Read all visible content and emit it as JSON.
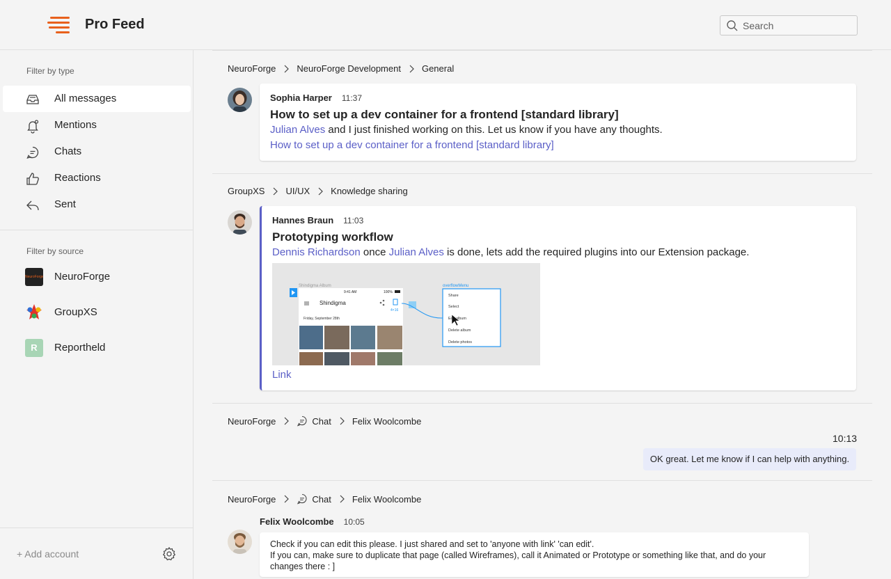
{
  "app": {
    "title": "Pro Feed"
  },
  "search": {
    "placeholder": "Search"
  },
  "sidebar": {
    "type_label": "Filter by type",
    "types": [
      {
        "label": "All messages",
        "icon": "inbox-icon",
        "active": true
      },
      {
        "label": "Mentions",
        "icon": "bell-icon"
      },
      {
        "label": "Chats",
        "icon": "chat-icon"
      },
      {
        "label": "Reactions",
        "icon": "thumbs-up-icon"
      },
      {
        "label": "Sent",
        "icon": "reply-icon"
      }
    ],
    "source_label": "Filter by source",
    "sources": [
      {
        "label": "NeuroForge",
        "logo_text": "NeuroForge"
      },
      {
        "label": "GroupXS"
      },
      {
        "label": "Reportheld",
        "initial": "R"
      }
    ],
    "add_account": "+ Add account"
  },
  "feed": [
    {
      "crumbs": [
        "NeuroForge",
        "NeuroForge Development",
        "General"
      ],
      "author": "Sophia Harper",
      "time": "11:37",
      "subject": "How to set up a dev container for a frontend [standard library]",
      "mention": "Julian Alves",
      "text": " and I just finished working on this. Let us know if you have any thoughts.",
      "link": "How to set up a dev container for a frontend [standard library]"
    },
    {
      "crumbs": [
        "GroupXS",
        "UI/UX",
        "Knowledge sharing"
      ],
      "author": "Hannes Braun",
      "time": "11:03",
      "subject": "Prototyping workflow",
      "mention1": "Dennis Richardson",
      "text1": " once ",
      "mention2": "Julian Alves",
      "text2": " is done, lets add the required plugins into our Extension package.",
      "link": "Link",
      "preview": {
        "album_label": "Shindigma Album",
        "status_time": "9:41 AM",
        "battery": "100%",
        "app_title": "Shindigma",
        "date": "Friday, September 28th",
        "size_label": "4×16",
        "menu_title": "overflowMenu",
        "menu_items": [
          "Share",
          "Select",
          "Edit album",
          "Delete album",
          "Delete photos"
        ]
      }
    },
    {
      "crumbs": [
        "NeuroForge",
        "Chat",
        "Felix Woolcombe"
      ],
      "time": "10:13",
      "text": "OK great. Let me know if I can help with anything."
    },
    {
      "crumbs": [
        "NeuroForge",
        "Chat",
        "Felix Woolcombe"
      ],
      "author": "Felix Woolcombe",
      "time": "10:05",
      "line1": "Check if you can edit this please. I just shared and set to 'anyone with link' 'can edit'.",
      "line2": "If you can, make sure to duplicate that page (called Wireframes), call it Animated or Prototype or something like that, and do your",
      "line3": "changes there : ]"
    }
  ],
  "colors": {
    "accent": "#5b5fc7",
    "brand": "#e8601c",
    "bubble": "#e8ebfa"
  }
}
